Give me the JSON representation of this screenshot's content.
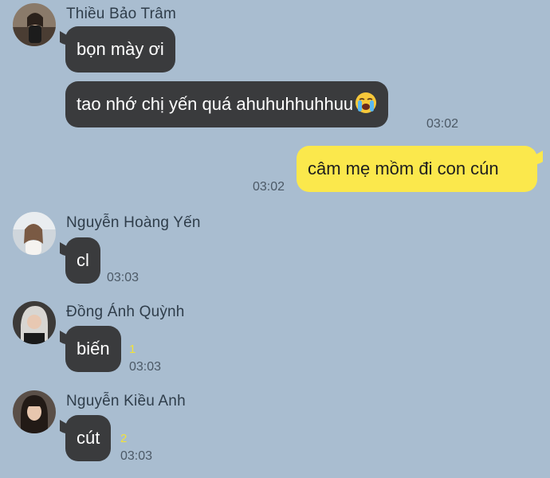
{
  "messages": [
    {
      "sender": "Thiều Bảo Trâm",
      "avatar_icon": "avatar-photo",
      "bubbles": [
        "bọn mày ơi",
        "tao nhớ chị yến quá ahuhuhhuhhuu"
      ],
      "emoji": "loudly-crying-face-emoji",
      "time": "03:02"
    },
    {
      "sender": "",
      "mine": true,
      "bubbles": [
        "câm mẹ mồm đi con cún"
      ],
      "time": "03:02"
    },
    {
      "sender": "Nguyễn Hoàng Yến",
      "avatar_icon": "avatar-photo",
      "bubbles": [
        "cl"
      ],
      "time": "03:03"
    },
    {
      "sender": "Đồng Ánh Quỳnh",
      "avatar_icon": "avatar-photo",
      "bubbles": [
        "biến"
      ],
      "unread": "1",
      "time": "03:03"
    },
    {
      "sender": "Nguyễn Kiều Anh",
      "avatar_icon": "avatar-photo",
      "bubbles": [
        "cút"
      ],
      "unread": "2",
      "time": "03:03"
    }
  ],
  "colors": {
    "background": "#a9bdd0",
    "incoming_bubble": "#3a3b3d",
    "outgoing_bubble": "#fbe84c",
    "unread_count": "#f2e23a"
  }
}
